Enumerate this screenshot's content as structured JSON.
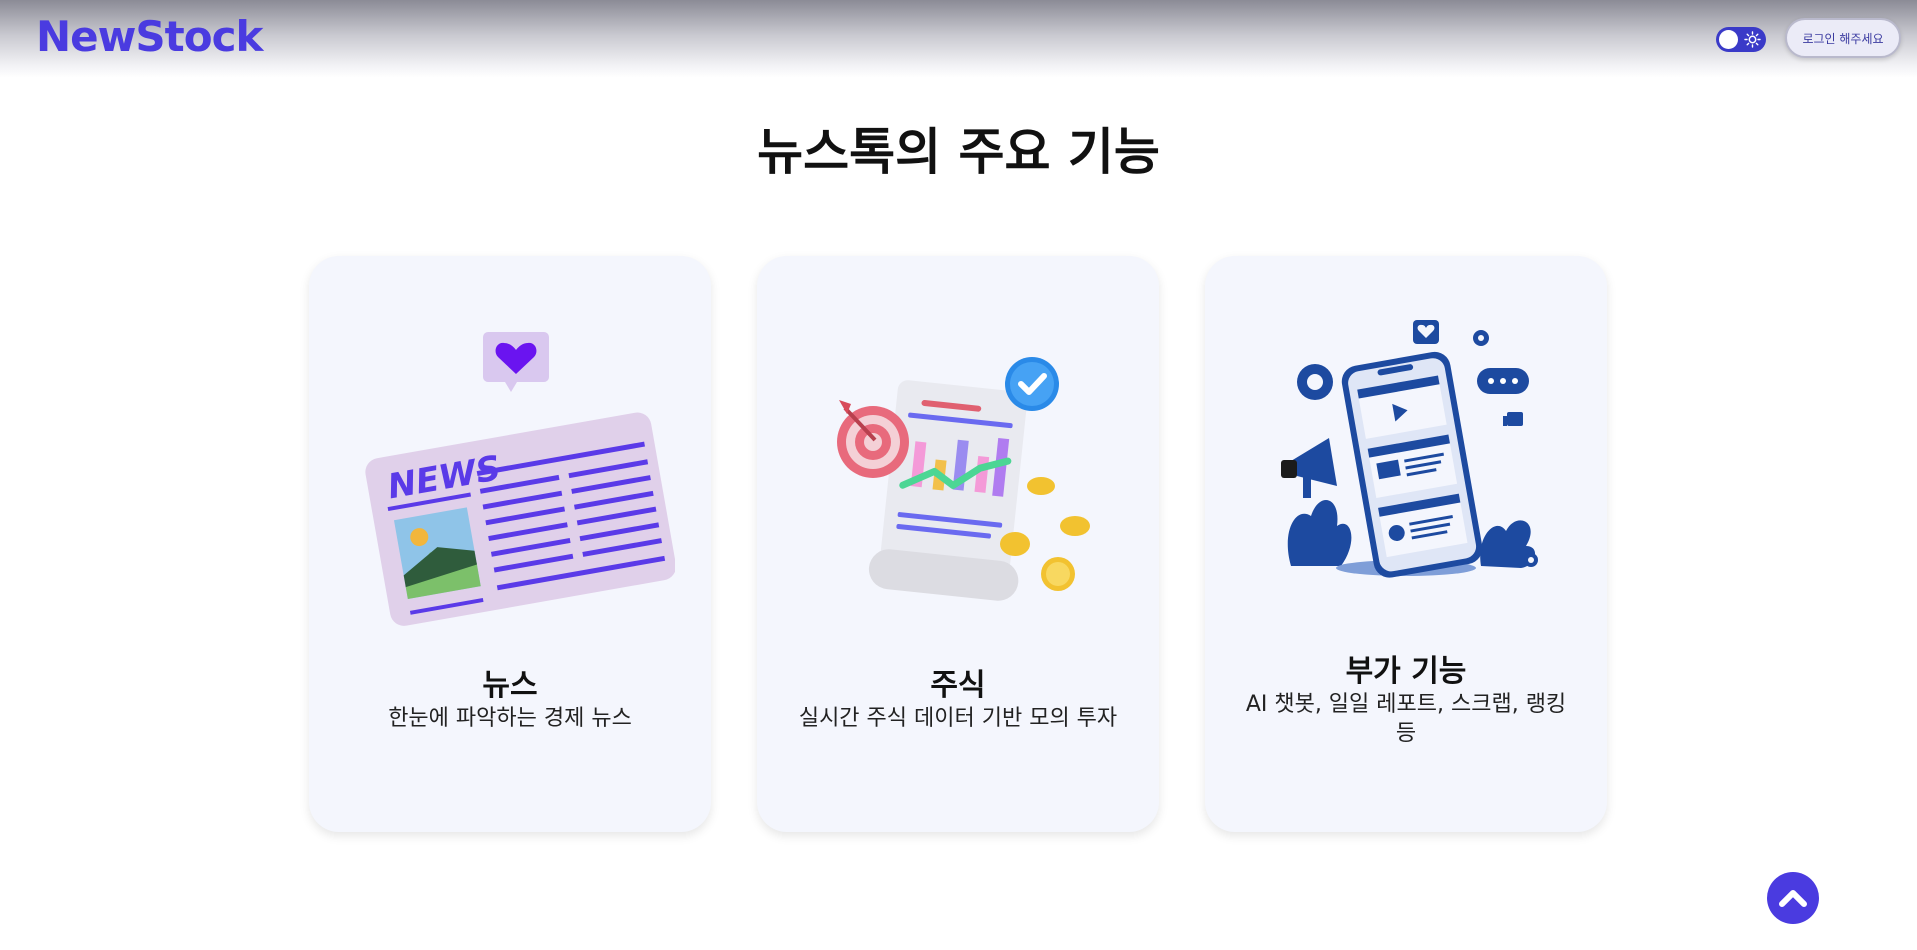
{
  "header": {
    "logo": "NewStock",
    "theme_toggle_icon": "sun-icon",
    "login_label": "로그인 해주세요"
  },
  "main": {
    "title": "뉴스톡의 주요 기능",
    "cards": [
      {
        "title": "뉴스",
        "description": "한눈에 파악하는 경제 뉴스",
        "illustration": "newspaper-illustration"
      },
      {
        "title": "주식",
        "description": "실시간 주식 데이터 기반 모의 투자",
        "illustration": "stock-chart-illustration"
      },
      {
        "title": "부가 기능",
        "description": "AI 챗봇, 일일 레포트, 스크랩, 랭킹 등",
        "illustration": "smartphone-marketing-illustration"
      }
    ]
  },
  "scroll_top_icon": "chevron-up-icon",
  "colors": {
    "brand": "#4a3be0",
    "card_bg": "#f4f6fd",
    "toggle": "#3a3ac8"
  }
}
